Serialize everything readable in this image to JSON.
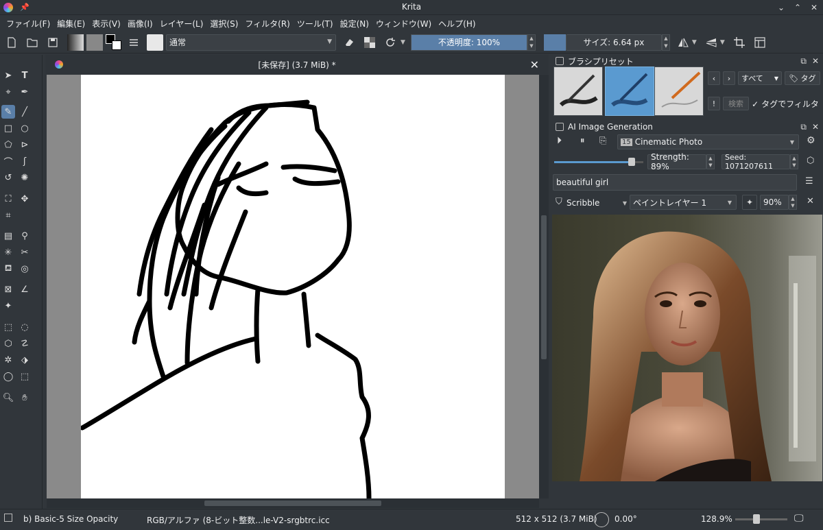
{
  "window": {
    "title": "Krita"
  },
  "menu": [
    "ファイル(F)",
    "編集(E)",
    "表示(V)",
    "画像(I)",
    "レイヤー(L)",
    "選択(S)",
    "フィルタ(R)",
    "ツール(T)",
    "設定(N)",
    "ウィンドウ(W)",
    "ヘルプ(H)"
  ],
  "toolbar": {
    "blend_mode": "通常",
    "opacity": "不透明度: 100%",
    "size": "サイズ: 6.64 px"
  },
  "document": {
    "title": "[未保存]  (3.7 MiB) *"
  },
  "brush_presets": {
    "title": "ブラシプリセット",
    "tag_filter": "すべて",
    "tag_button": "タグ",
    "search_placeholder": "検索",
    "filter_by_tag": "タグでフィルタ"
  },
  "ai_generation": {
    "title": "AI Image Generation",
    "style": "Cinematic Photo",
    "strength": "Strength: 89%",
    "strength_value": 0.89,
    "seed": "Seed: 1071207611",
    "prompt": "beautiful girl",
    "control_mode": "Scribble",
    "control_layer": "ペイントレイヤー 1",
    "control_strength": "90%"
  },
  "status": {
    "brush": "b) Basic-5 Size Opacity",
    "color_profile": "RGB/アルファ (8-ビット整数...le-V2-srgbtrc.icc",
    "image_size": "512 x 512 (3.7 MiB)",
    "rotation": "0.00°",
    "zoom": "128.9%"
  }
}
